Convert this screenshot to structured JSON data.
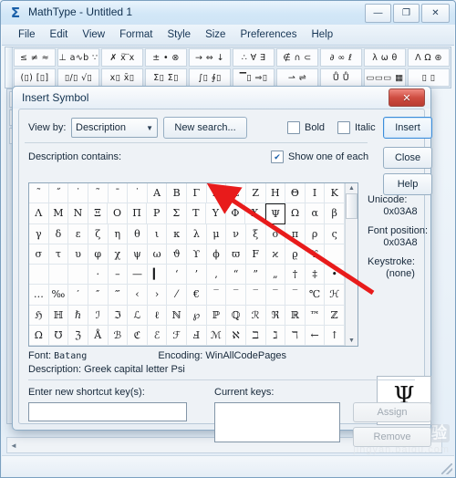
{
  "window": {
    "title": "MathType - Untitled 1",
    "icon": "sigma-icon",
    "buttons": {
      "minimize": "—",
      "maximize": "❐",
      "close": "✕"
    },
    "menu": [
      "File",
      "Edit",
      "View",
      "Format",
      "Style",
      "Size",
      "Preferences",
      "Help"
    ]
  },
  "toolbar": {
    "row1": [
      "≤ ≠ ≈",
      "⊥ a∿b ∵",
      "✗ ẍ ⃛x",
      "± • ⊗",
      "→ ⇔ ↓",
      "∴ ∀ ∃",
      "∉ ∩ ⊂",
      "∂ ∞ ℓ",
      "λ ω θ",
      "Λ Ω ⊛"
    ],
    "row2": [
      "(▯) [▯]",
      "▯/▯ √▯",
      "x▯ x̄▯",
      "Σ▯ Σ▯",
      "∫▯ ∮▯",
      "▔▯ ⇒▯",
      "⇀ ⇌",
      "Ů Ů",
      "▭▭▭ ▦",
      "▯ ▯"
    ]
  },
  "dialog": {
    "title": "Insert Symbol",
    "close_button": "✕",
    "view_by_label": "View by:",
    "view_by_value": "Description",
    "new_search_button": "New search...",
    "bold_label": "Bold",
    "bold_checked": false,
    "italic_label": "Italic",
    "italic_checked": false,
    "insert_button": "Insert",
    "close_text_button": "Close",
    "help_button": "Help",
    "description_contains_label": "Description contains:",
    "show_one_of_each_label": "Show one of each",
    "show_one_of_each_checked": true,
    "font_label": "Font:",
    "font_value": "Batang",
    "encoding_label": "Encoding:",
    "encoding_value": "WinAllCodePages",
    "description_label": "Description:",
    "description_value": "Greek capital letter Psi",
    "unicode_label": "Unicode:",
    "unicode_value": "0x03A8",
    "font_position_label": "Font position:",
    "font_position_value": "0x03A8",
    "keystroke_label": "Keystroke:",
    "keystroke_value": "(none)",
    "preview_glyph": "Ψ",
    "enter_shortcut_label": "Enter new shortcut key(s):",
    "enter_shortcut_value": "",
    "current_keys_label": "Current keys:",
    "current_keys_value": "",
    "assign_button": "Assign",
    "remove_button": "Remove",
    "selected_symbol": "Ψ",
    "selected_row": 1,
    "selected_col": 12,
    "grid_rows": [
      [
        "˜",
        "˝",
        "˙",
        "˜",
        "¯",
        "˙",
        "Α",
        "Β",
        "Γ",
        "Δ",
        "Ε",
        "Ζ",
        "Η",
        "Θ",
        "Ι",
        "Κ"
      ],
      [
        "Λ",
        "Μ",
        "Ν",
        "Ξ",
        "Ο",
        "Π",
        "Ρ",
        "Σ",
        "Τ",
        "Υ",
        "Φ",
        "Χ",
        "Ψ",
        "Ω",
        "α",
        "β"
      ],
      [
        "γ",
        "δ",
        "ε",
        "ζ",
        "η",
        "θ",
        "ι",
        "κ",
        "λ",
        "μ",
        "ν",
        "ξ",
        "ο",
        "π",
        "ρ",
        "ς"
      ],
      [
        "σ",
        "τ",
        "υ",
        "φ",
        "χ",
        "ψ",
        "ω",
        "ϑ",
        "ϒ",
        "ϕ",
        "ϖ",
        "F",
        "ϰ",
        "ϱ",
        "ϒ",
        ""
      ],
      [
        "",
        "",
        "",
        "·",
        "–",
        "—",
        "▎",
        "‘",
        "’",
        "‚",
        "“",
        "”",
        "„",
        "†",
        "‡",
        "•"
      ],
      [
        "…",
        "‰",
        "′",
        "″",
        "‴",
        "‹",
        "›",
        "⁄",
        "€",
        "‾",
        "‾",
        "‾",
        "‾",
        "‾",
        "℃",
        "ℋ"
      ],
      [
        "ℌ",
        "ℍ",
        "ℏ",
        "ℐ",
        "ℑ",
        "ℒ",
        "ℓ",
        "ℕ",
        "℘",
        "ℙ",
        "ℚ",
        "ℛ",
        "ℜ",
        "ℝ",
        "™",
        "ℤ"
      ],
      [
        "Ω",
        "℧",
        "ℨ",
        "Å",
        "ℬ",
        "ℭ",
        "ℰ",
        "ℱ",
        "Ⅎ",
        "ℳ",
        "ℵ",
        "ℶ",
        "ℷ",
        "ℸ",
        "←",
        "↑"
      ]
    ]
  },
  "watermark": {
    "line1": "Baidu",
    "badge": "经验",
    "line2": "jingyan.baidu.com"
  }
}
